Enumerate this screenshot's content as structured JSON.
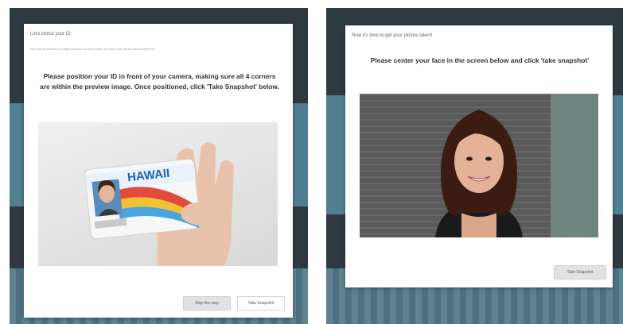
{
  "left_panel": {
    "modal_title": "Let's check your ID",
    "modal_note": "We'll use the preview to confirm that your ID can be read. The photo will only be used to verify you.",
    "instructions": "Please position your ID in front of your camera, making sure all 4 corners are within the preview image. Once positioned, click 'Take Snapshot' below.",
    "card_state": "HAWAII",
    "buttons": {
      "secondary": "Skip this step",
      "primary": "Take Snapshot"
    }
  },
  "right_panel": {
    "modal_title": "Now it's time to get your picture taken!",
    "instructions": "Please center your face in the screen below and click 'take snapshot'",
    "buttons": {
      "primary": "Take Snapshot"
    }
  },
  "colors": {
    "page_bg": "#2f3a40",
    "accent": "#4f7f91",
    "modal_bg": "#ffffff"
  }
}
